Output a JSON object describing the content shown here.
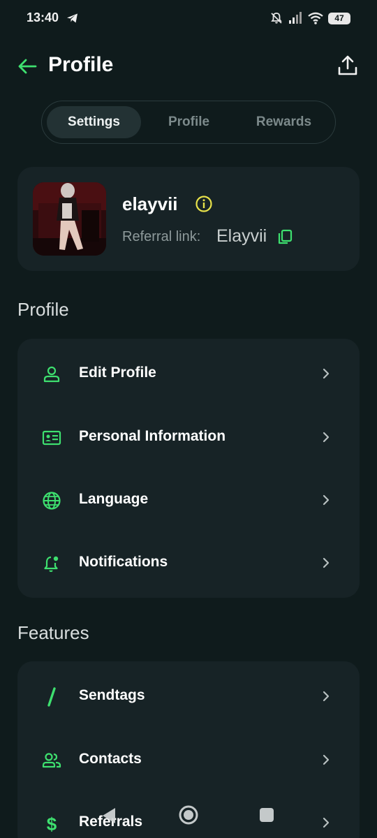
{
  "status_bar": {
    "time": "13:40",
    "battery": "47"
  },
  "header": {
    "title": "Profile"
  },
  "tabs": [
    {
      "label": "Settings",
      "active": true
    },
    {
      "label": "Profile",
      "active": false
    },
    {
      "label": "Rewards",
      "active": false
    }
  ],
  "user": {
    "username": "elayvii",
    "referral_label": "Referral link:",
    "referral_value": "Elayvii"
  },
  "profile_section": {
    "title": "Profile",
    "items": [
      {
        "label": "Edit Profile",
        "icon": "person-icon"
      },
      {
        "label": "Personal Information",
        "icon": "id-card-icon"
      },
      {
        "label": "Language",
        "icon": "globe-icon"
      },
      {
        "label": "Notifications",
        "icon": "bell-icon"
      }
    ]
  },
  "features_section": {
    "title": "Features",
    "items": [
      {
        "label": "Sendtags",
        "icon": "slash-icon"
      },
      {
        "label": "Contacts",
        "icon": "contacts-icon"
      },
      {
        "label": "Referrals",
        "icon": "dollar-icon"
      }
    ]
  },
  "colors": {
    "accent": "#3ee06f",
    "background": "#0f1b1c",
    "card": "#172326",
    "info": "#e8e24a"
  }
}
